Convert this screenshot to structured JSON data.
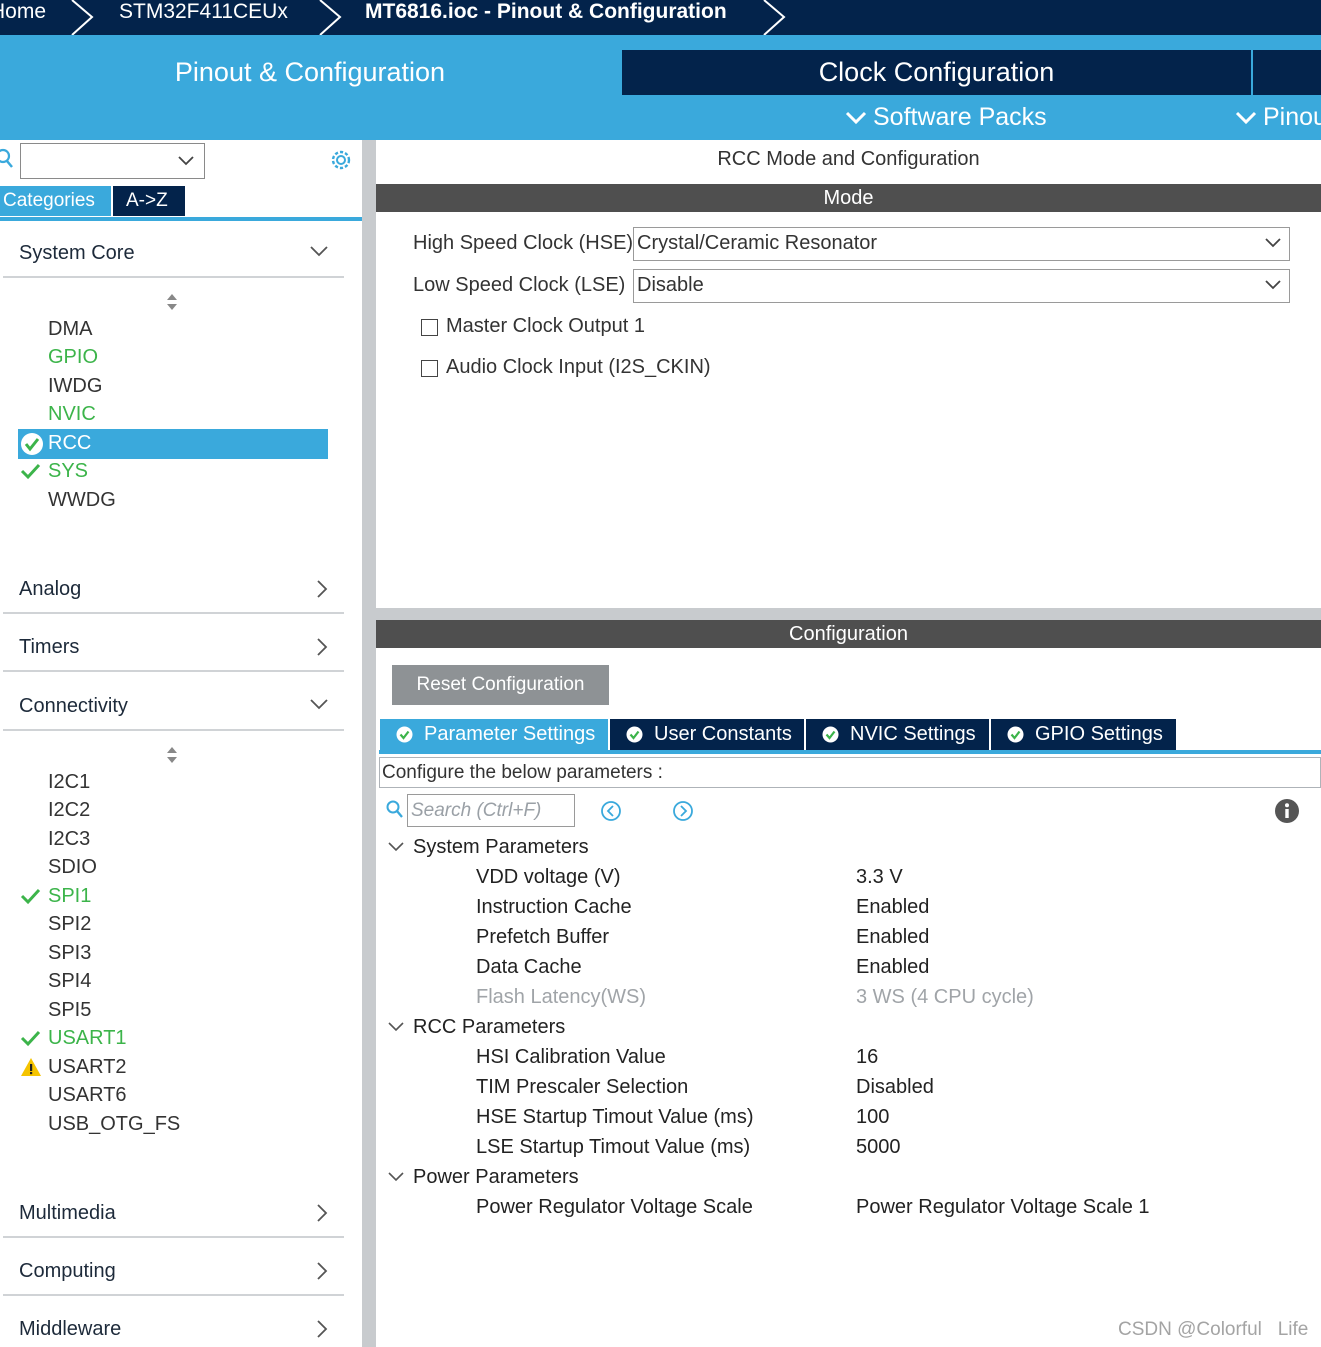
{
  "breadcrumb": {
    "items": [
      "Home",
      "STM32F411CEUx",
      "MT6816.ioc - Pinout & Configuration"
    ]
  },
  "main_tabs": {
    "pinout": "Pinout & Configuration",
    "clock": "Clock Configuration"
  },
  "submenus": {
    "software_packs": "Software Packs",
    "pinout": "Pinout"
  },
  "left_panel": {
    "search_placeholder": "",
    "tabs": {
      "categories": "Categories",
      "az": "A->Z"
    },
    "groups": {
      "system_core": "System Core",
      "analog": "Analog",
      "timers": "Timers",
      "connectivity": "Connectivity",
      "multimedia": "Multimedia",
      "computing": "Computing",
      "middleware": "Middleware"
    },
    "system_core_items": [
      {
        "label": "DMA",
        "status": "none"
      },
      {
        "label": "GPIO",
        "status": "configured"
      },
      {
        "label": "IWDG",
        "status": "none"
      },
      {
        "label": "NVIC",
        "status": "configured"
      },
      {
        "label": "RCC",
        "status": "selected-ok"
      },
      {
        "label": "SYS",
        "status": "ok"
      },
      {
        "label": "WWDG",
        "status": "none"
      }
    ],
    "connectivity_items": [
      {
        "label": "I2C1",
        "status": "none"
      },
      {
        "label": "I2C2",
        "status": "none"
      },
      {
        "label": "I2C3",
        "status": "none"
      },
      {
        "label": "SDIO",
        "status": "none"
      },
      {
        "label": "SPI1",
        "status": "ok"
      },
      {
        "label": "SPI2",
        "status": "none"
      },
      {
        "label": "SPI3",
        "status": "none"
      },
      {
        "label": "SPI4",
        "status": "none"
      },
      {
        "label": "SPI5",
        "status": "none"
      },
      {
        "label": "USART1",
        "status": "ok"
      },
      {
        "label": "USART2",
        "status": "warning"
      },
      {
        "label": "USART6",
        "status": "none"
      },
      {
        "label": "USB_OTG_FS",
        "status": "none"
      }
    ]
  },
  "right_panel": {
    "title": "RCC Mode and Configuration",
    "mode_header": "Mode",
    "hse_label": "High Speed Clock (HSE)",
    "hse_value": "Crystal/Ceramic Resonator",
    "lse_label": "Low Speed Clock (LSE)",
    "lse_value": "Disable",
    "mco1_label": "Master Clock Output 1",
    "i2s_label": "Audio Clock Input (I2S_CKIN)",
    "config_header": "Configuration",
    "reset_button": "Reset Configuration",
    "config_tabs": [
      "Parameter Settings",
      "User Constants",
      "NVIC Settings",
      "GPIO Settings"
    ],
    "hint": "Configure the below parameters :",
    "search_placeholder": "Search (Ctrl+F)",
    "param_groups": {
      "system": "System Parameters",
      "rcc": "RCC Parameters",
      "power": "Power Parameters"
    },
    "system_params": [
      {
        "name": "VDD voltage (V)",
        "value": "3.3 V",
        "muted": false
      },
      {
        "name": "Instruction Cache",
        "value": "Enabled",
        "muted": false
      },
      {
        "name": "Prefetch Buffer",
        "value": "Enabled",
        "muted": false
      },
      {
        "name": "Data Cache",
        "value": "Enabled",
        "muted": false
      },
      {
        "name": "Flash Latency(WS)",
        "value": "3 WS (4 CPU cycle)",
        "muted": true
      }
    ],
    "rcc_params": [
      {
        "name": "HSI Calibration Value",
        "value": "16"
      },
      {
        "name": "TIM Prescaler Selection",
        "value": "Disabled"
      },
      {
        "name": "HSE Startup Timout Value (ms)",
        "value": "100"
      },
      {
        "name": "LSE Startup Timout Value (ms)",
        "value": "5000"
      }
    ],
    "power_params": [
      {
        "name": "Power Regulator Voltage Scale",
        "value": "Power Regulator Voltage Scale 1"
      }
    ]
  },
  "watermark": "CSDN @Colorful   Life",
  "colors": {
    "navy": "#03234b",
    "accent": "#3aa9dc",
    "ok_green": "#3cb44a",
    "warning": "#f5c400"
  }
}
